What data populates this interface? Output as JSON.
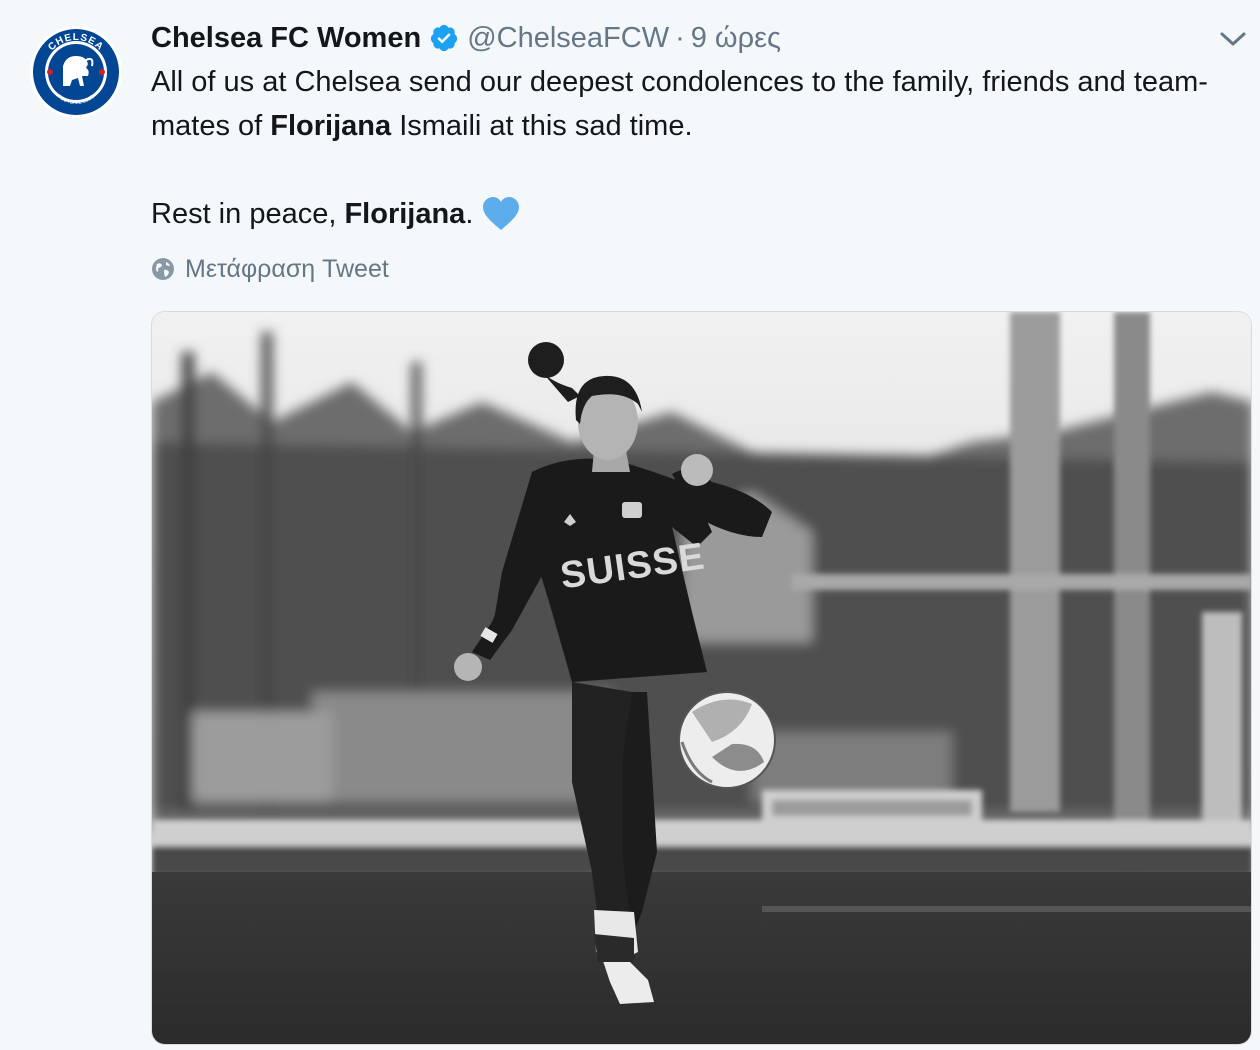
{
  "tweet": {
    "author_name": "Chelsea FC Women",
    "handle": "@ChelseaFCW",
    "separator": "·",
    "time": "9 ώρες",
    "text_line1_a": "All of us at Chelsea send our deepest condolences to the family, friends and team-mates of ",
    "text_line1_bold": "Florijana",
    "text_line1_b": " Ismaili at this sad time.",
    "text_line2_a": "Rest in peace, ",
    "text_line2_bold": "Florijana",
    "text_line2_b": ".",
    "translate_label": "Μετάφραση Tweet",
    "avatar_label": "CHELSEA",
    "avatar_sublabel": "FOOTBALL CLUB",
    "jersey_text": "SUISSE"
  },
  "icons": {
    "verified": "verified-badge-icon",
    "caret": "chevron-down-icon",
    "heart": "blue-heart-icon",
    "globe": "globe-icon"
  },
  "colors": {
    "background": "#f5f8fa",
    "text": "#14171a",
    "muted": "#657786",
    "verified": "#1da1f2",
    "heart": "#5dadec",
    "chelsea_blue": "#034694"
  }
}
